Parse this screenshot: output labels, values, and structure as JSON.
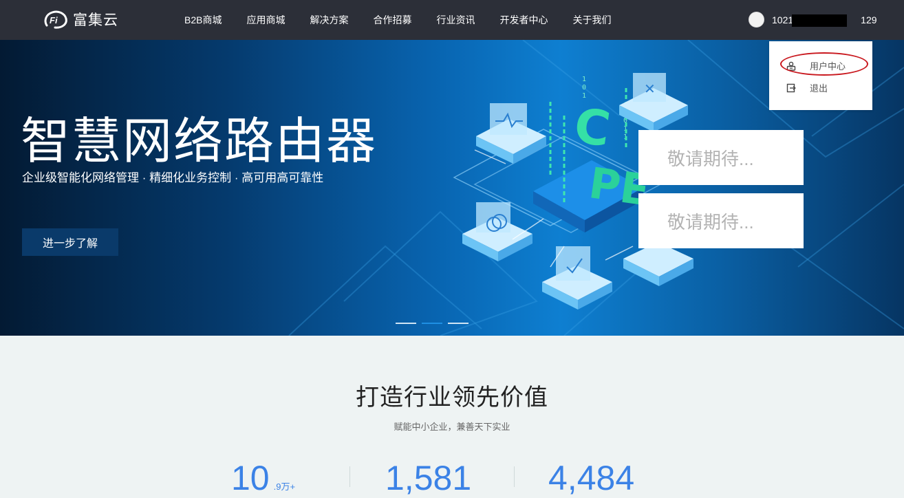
{
  "header": {
    "logo_text": "富集云",
    "nav": [
      "B2B商城",
      "应用商城",
      "解决方案",
      "合作招募",
      "行业资讯",
      "开发者中心",
      "关于我们"
    ],
    "user_prefix": "1021",
    "user_suffix": "129"
  },
  "dropdown": {
    "user_center": "用户中心",
    "logout": "退出"
  },
  "banner": {
    "title": "智慧网络路由器",
    "subtitle": "企业级智能化网络管理 · 精细化业务控制 · 高可用高可靠性",
    "button": "进一步了解",
    "coming_soon_1": "敬请期待...",
    "coming_soon_2": "敬请期待...",
    "active_slide": 2,
    "slide_count": 3
  },
  "section": {
    "title": "打造行业领先价值",
    "subtitle": "赋能中小企业，兼善天下实业",
    "stats": [
      {
        "value": "10",
        "unit": ".9万+"
      },
      {
        "value": "1,581",
        "unit": ""
      },
      {
        "value": "4,484",
        "unit": ""
      }
    ]
  },
  "colors": {
    "header_bg": "#2c2f38",
    "accent_blue": "#3b82e6",
    "highlight_red": "#c9181e"
  }
}
